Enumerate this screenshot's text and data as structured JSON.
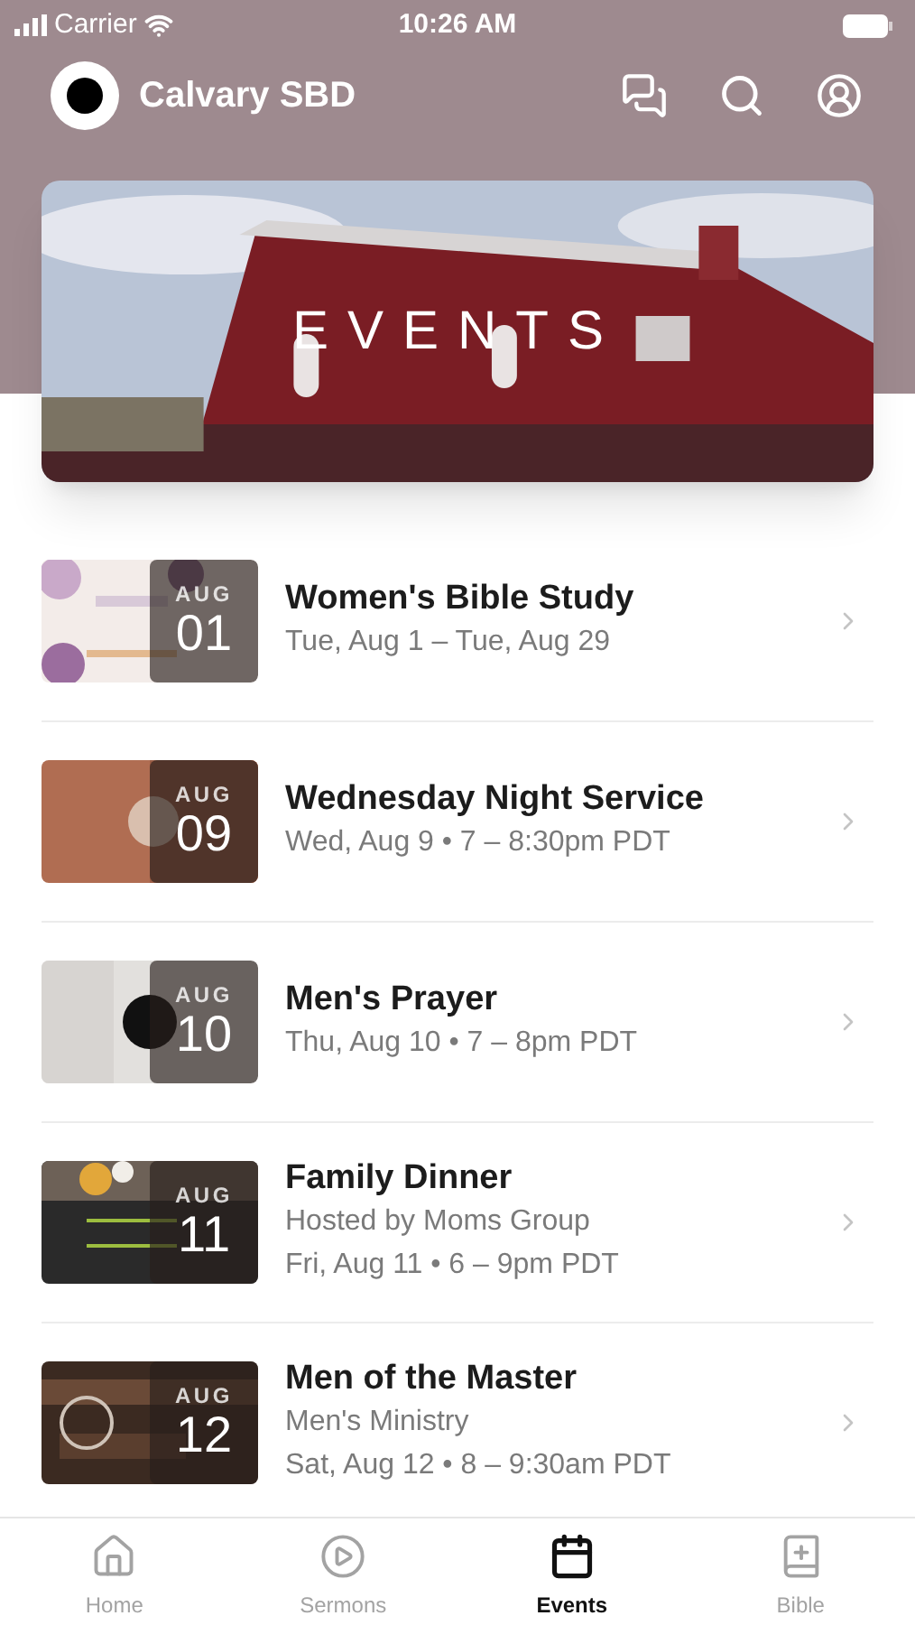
{
  "status_bar": {
    "carrier": "Carrier",
    "time": "10:26 AM"
  },
  "header": {
    "title": "Calvary SBD"
  },
  "banner": {
    "title": "EVENTS"
  },
  "events": [
    {
      "month": "AUG",
      "day": "01",
      "title": "Women's Bible Study",
      "lines": [
        "Tue, Aug 1 – Tue, Aug 29"
      ]
    },
    {
      "month": "AUG",
      "day": "09",
      "title": "Wednesday Night Service",
      "lines": [
        "Wed, Aug 9 • 7 – 8:30pm PDT"
      ]
    },
    {
      "month": "AUG",
      "day": "10",
      "title": "Men's Prayer",
      "lines": [
        "Thu, Aug 10 • 7 – 8pm PDT"
      ]
    },
    {
      "month": "AUG",
      "day": "11",
      "title": "Family Dinner",
      "lines": [
        "Hosted by Moms Group",
        "Fri, Aug 11 • 6 – 9pm PDT"
      ]
    },
    {
      "month": "AUG",
      "day": "12",
      "title": "Men of the Master",
      "lines": [
        "Men's Ministry",
        "Sat, Aug 12 • 8 – 9:30am PDT"
      ]
    }
  ],
  "tabs": [
    {
      "label": "Home",
      "kind": "home",
      "selected": false
    },
    {
      "label": "Sermons",
      "kind": "sermons",
      "selected": false
    },
    {
      "label": "Events",
      "kind": "events",
      "selected": true
    },
    {
      "label": "Bible",
      "kind": "bible",
      "selected": false
    }
  ]
}
